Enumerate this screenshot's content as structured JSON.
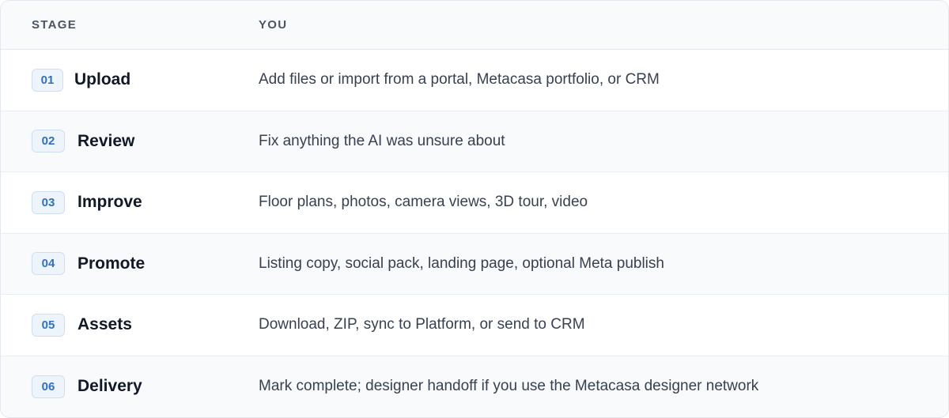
{
  "table": {
    "headers": {
      "stage": "STAGE",
      "you": "YOU"
    },
    "rows": [
      {
        "num": "01",
        "name": "Upload",
        "you": "Add files or import from a portal, Metacasa portfolio, or CRM"
      },
      {
        "num": "02",
        "name": "Review",
        "you": "Fix anything the AI was unsure about"
      },
      {
        "num": "03",
        "name": "Improve",
        "you": "Floor plans, photos, camera views, 3D tour, video"
      },
      {
        "num": "04",
        "name": "Promote",
        "you": "Listing copy, social pack, landing page, optional Meta publish"
      },
      {
        "num": "05",
        "name": "Assets",
        "you": "Download, ZIP, sync to Platform, or send to CRM"
      },
      {
        "num": "06",
        "name": "Delivery",
        "you": "Mark complete; designer handoff if you use the Metacasa designer network"
      }
    ]
  },
  "colors": {
    "badge_text": "#2f6fc4",
    "badge_bg": "#eef4fc",
    "header_bg": "#f8fafc",
    "border": "#e3e7ee"
  }
}
